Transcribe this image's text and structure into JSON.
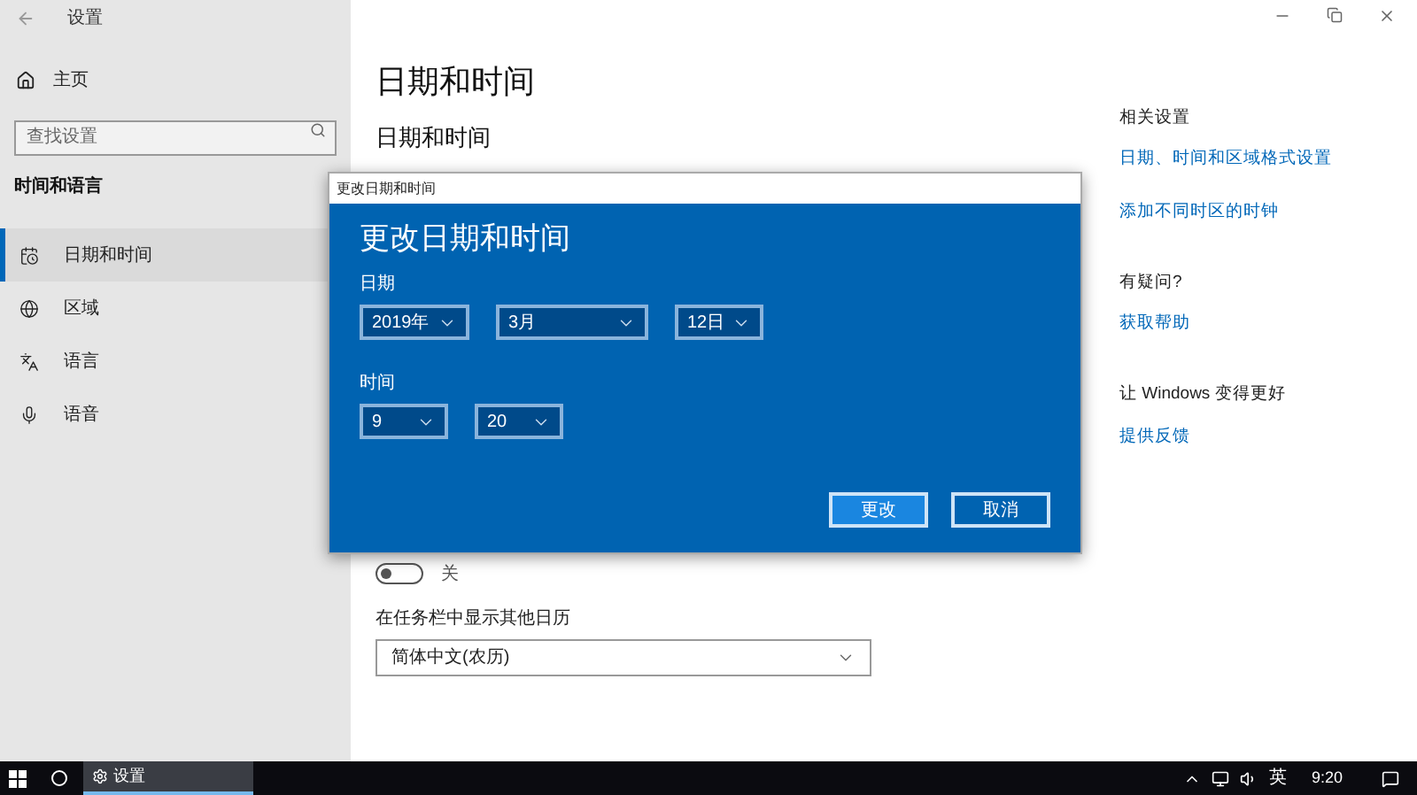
{
  "window": {
    "title": "设置"
  },
  "sidebar": {
    "home": "主页",
    "search": {
      "placeholder": "查找设置"
    },
    "section": "时间和语言",
    "items": [
      {
        "label": "日期和时间",
        "selected": true
      },
      {
        "label": "区域",
        "selected": false
      },
      {
        "label": "语言",
        "selected": false
      },
      {
        "label": "语音",
        "selected": false
      }
    ]
  },
  "page": {
    "title": "日期和时间",
    "subtitle": "日期和时间",
    "toggle": {
      "on": false,
      "state_label": "关"
    },
    "calendar_label": "在任务栏中显示其他日历",
    "calendar_select": {
      "value": "简体中文(农历)"
    }
  },
  "related": [
    {
      "heading": "相关设置",
      "links": [
        "日期、时间和区域格式设置",
        "添加不同时区的时钟"
      ]
    },
    {
      "heading": "有疑问?",
      "links": [
        "获取帮助"
      ]
    },
    {
      "heading": "让 Windows 变得更好",
      "links": [
        "提供反馈"
      ]
    }
  ],
  "dialog": {
    "title": "更改日期和时间",
    "heading": "更改日期和时间",
    "date_label": "日期",
    "date_fields": [
      {
        "value": "2019年"
      },
      {
        "value": "3月"
      },
      {
        "value": "12日"
      }
    ],
    "time_label": "时间",
    "time_fields": [
      {
        "value": "9"
      },
      {
        "value": "20"
      }
    ],
    "buttons": [
      {
        "label": "更改",
        "selected": true
      },
      {
        "label": "取消",
        "selected": false
      }
    ]
  },
  "taskbar": {
    "task": "设置",
    "language": "英",
    "time": "9:20"
  }
}
